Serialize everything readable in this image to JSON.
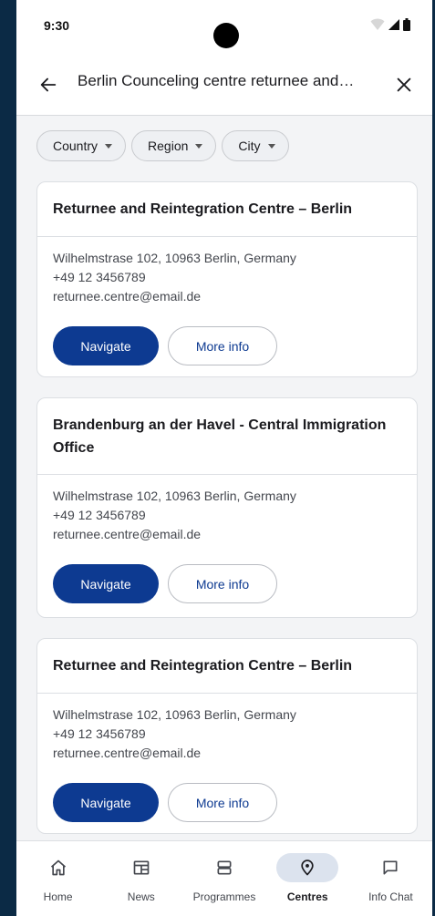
{
  "status_bar": {
    "time": "9:30"
  },
  "app_bar": {
    "title": "Berlin Counceling centre returnee and…"
  },
  "filters": [
    {
      "label": "Country"
    },
    {
      "label": "Region"
    },
    {
      "label": "City"
    }
  ],
  "centres": [
    {
      "title": "Returnee and Reintegration Centre – Berlin",
      "address": "Wilhelmstrase 102, 10963 Berlin, Germany",
      "phone": "+49 12 3456789",
      "email": "returnee.centre@email.de",
      "navigate_label": "Navigate",
      "more_label": "More info"
    },
    {
      "title": "Brandenburg an der Havel - Central Immigration Office",
      "address": "Wilhelmstrase 102, 10963 Berlin, Germany",
      "phone": "+49 12 3456789",
      "email": "returnee.centre@email.de",
      "navigate_label": "Navigate",
      "more_label": "More info"
    },
    {
      "title": "Returnee and Reintegration Centre – Berlin",
      "address": "Wilhelmstrase 102, 10963 Berlin, Germany",
      "phone": "+49 12 3456789",
      "email": "returnee.centre@email.de",
      "navigate_label": "Navigate",
      "more_label": "More info"
    }
  ],
  "bottom_nav": [
    {
      "label": "Home",
      "icon": "home-icon"
    },
    {
      "label": "News",
      "icon": "news-icon"
    },
    {
      "label": "Programmes",
      "icon": "programmes-icon"
    },
    {
      "label": "Centres",
      "icon": "location-pin-icon",
      "active": true
    },
    {
      "label": "Info Chat",
      "icon": "chat-icon"
    }
  ],
  "colors": {
    "primary": "#0d3a91",
    "active_nav_bg": "#dce3ee",
    "background": "#f3f4f6",
    "outer_frame": "#0b2a45"
  }
}
